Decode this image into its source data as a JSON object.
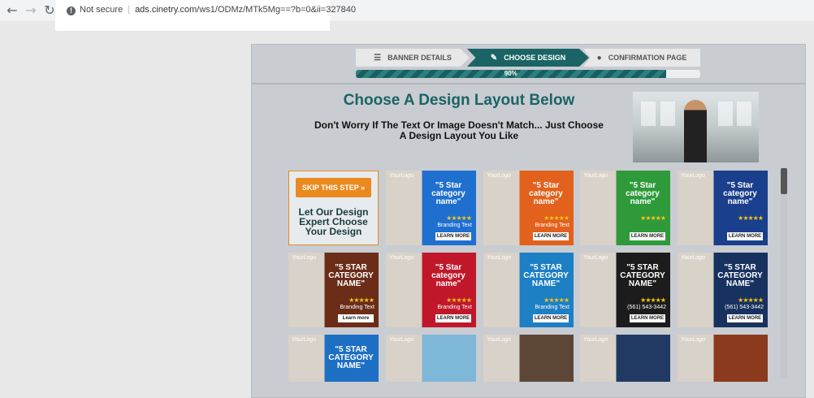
{
  "browser": {
    "security_label": "Not secure",
    "url_host": "ads.cinetry.com",
    "url_path": "/ws1/ODMz/MTk5Mg==?b=0&ii=327840"
  },
  "steps": [
    {
      "label": "BANNER DETAILS",
      "icon": "list-icon"
    },
    {
      "label": "CHOOSE DESIGN",
      "icon": "brush-icon"
    },
    {
      "label": "CONFIRMATION PAGE",
      "icon": "circle-icon"
    }
  ],
  "progress": {
    "value": 90,
    "label": "90%"
  },
  "heading": "Choose A Design Layout Below",
  "subheading": "Don't Worry If The Text Or Image Doesn't Match... Just Choose A Design Layout You Like",
  "skip": {
    "button_label": "SKIP THIS STEP »",
    "text": "Let Our Design Expert Choose Your Design"
  },
  "templates": [
    {
      "logo": "YourLogo",
      "cat": "\"5 Star category name\"",
      "brand": "Branding Text",
      "learn": "LEARN MORE",
      "bg": "#1f6fcf"
    },
    {
      "logo": "YourLogo",
      "cat": "\"5 Star category name\"",
      "brand": "Branding Text",
      "learn": "LEARN MORE",
      "bg": "#e2611c"
    },
    {
      "logo": "YourLogo",
      "cat": "\"5 Star category name\"",
      "brand": "",
      "learn": "LEARN MORE",
      "bg": "#2e9a3a"
    },
    {
      "logo": "YourLogo",
      "cat": "\"5 Star category name\"",
      "brand": "",
      "learn": "LEARN MORE",
      "bg": "#1a3f8c"
    },
    {
      "logo": "YourLogo",
      "cat": "\"5 STAR CATEGORY NAME\"",
      "brand": "Branding Text",
      "learn": "Learn more",
      "bg": "#6b2d18"
    },
    {
      "logo": "YourLogo",
      "cat": "\"5 Star category name\"",
      "brand": "Branding Text",
      "learn": "LEARN MORE",
      "bg": "#c0182a"
    },
    {
      "logo": "YourLogo",
      "cat": "\"5 STAR CATEGORY NAME\"",
      "brand": "Branding Text",
      "learn": "LEARN MORE",
      "bg": "#1d7fc4"
    },
    {
      "logo": "YourLogo",
      "cat": "\"5 STAR CATEGORY NAME\"",
      "brand": "(561) 543-3442",
      "learn": "LEARN MORE",
      "bg": "#1c1c1c"
    },
    {
      "logo": "YourLogo",
      "cat": "\"5 STAR CATEGORY NAME\"",
      "brand": "(561) 543-3442",
      "learn": "LEARN MORE",
      "bg": "#17325e"
    },
    {
      "logo": "YourLogo",
      "cat": "\"5 STAR CATEGORY NAME\"",
      "brand": "",
      "learn": "",
      "bg": "#1d6fc4"
    },
    {
      "logo": "YourLogo",
      "cat": "",
      "brand": "",
      "learn": "",
      "bg": "#7fb7d9"
    },
    {
      "logo": "YourLogo",
      "cat": "",
      "brand": "",
      "learn": "",
      "bg": "#5d4636"
    },
    {
      "logo": "YourLogo",
      "cat": "",
      "brand": "",
      "learn": "",
      "bg": "#213a63"
    },
    {
      "logo": "YourLogo",
      "cat": "",
      "brand": "",
      "learn": "",
      "bg": "#8c3a1e"
    }
  ]
}
